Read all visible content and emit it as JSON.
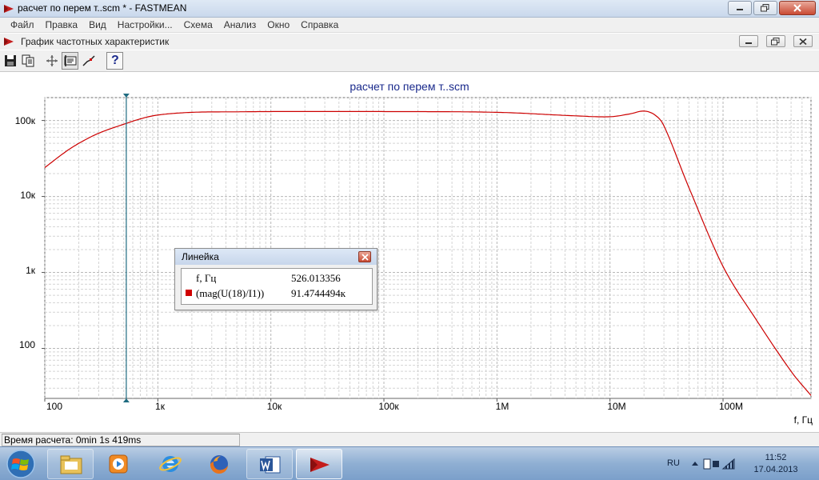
{
  "window": {
    "title": "расчет по перем т..scm * - FASTMEAN"
  },
  "menu": [
    "Файл",
    "Правка",
    "Вид",
    "Настройки...",
    "Схема",
    "Анализ",
    "Окно",
    "Справка"
  ],
  "child_window": {
    "title": "График частотных характеристик"
  },
  "toolbar": {
    "icons": [
      "save-icon",
      "copy-icon",
      "move-icon",
      "ruler-icon",
      "line-icon",
      "help-icon"
    ],
    "help_label": "?"
  },
  "plot": {
    "title": "расчет по перем т..scm",
    "y_ticks": [
      "100к",
      "10к",
      "1к",
      "100"
    ],
    "x_ticks": [
      "100",
      "1к",
      "10к",
      "100к",
      "1M",
      "10M",
      "100M"
    ],
    "x_axis_name": "f, Гц"
  },
  "chart_data": {
    "type": "line",
    "title": "расчет по перем т..scm",
    "xlabel": "f, Гц",
    "ylabel": "",
    "x_scale": "log",
    "y_scale": "log",
    "xlim": [
      100,
      600000000
    ],
    "ylim": [
      22,
      200000
    ],
    "grid": true,
    "series": [
      {
        "name": "(mag(U(18)/I1))",
        "color": "#cc0000",
        "x": [
          100,
          150,
          200,
          300,
          526,
          700,
          1000,
          2000,
          5000,
          10000,
          100000,
          1000000,
          5000000,
          10000000,
          15000000,
          20000000,
          25000000,
          30000000,
          50000000,
          100000000,
          200000000,
          400000000,
          600000000
        ],
        "y": [
          24000,
          38000,
          50000,
          68000,
          91474,
          105000,
          118000,
          128000,
          130000,
          131000,
          131000,
          128000,
          115000,
          112000,
          122000,
          133000,
          118000,
          85000,
          13000,
          1200,
          230,
          50,
          24
        ]
      }
    ],
    "cursor": {
      "x": 526.013356,
      "y": 91474.4494
    }
  },
  "ruler": {
    "title": "Линейка",
    "rows": [
      {
        "name": "f, Гц",
        "value": "526.013356"
      },
      {
        "name": "(mag(U(18)/I1))",
        "value": "91.4744494к"
      }
    ]
  },
  "status": {
    "text": "Время расчета: 0min 1s 419ms"
  },
  "taskbar": {
    "apps": [
      "file-explorer",
      "media-player",
      "internet-explorer",
      "firefox",
      "word",
      "fastmean"
    ],
    "language": "RU",
    "time": "11:52",
    "date": "17.04.2013"
  }
}
